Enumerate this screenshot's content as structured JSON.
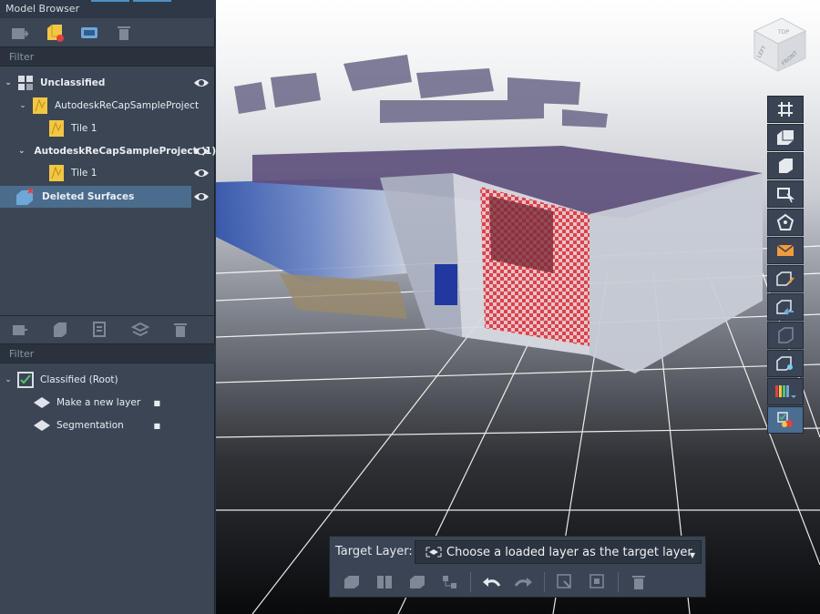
{
  "model_browser": {
    "title": "Model Browser",
    "filter_placeholder": "Filter",
    "toolbar_icons": [
      "import-icon",
      "add-layer-icon",
      "scan-icon",
      "trash-icon"
    ],
    "tree": {
      "unclassified": "Unclassified",
      "project_1": "AutodeskReCapSampleProject",
      "tile_1a": "Tile 1",
      "project_2": "AutodeskReCapSampleProject (1)",
      "tile_1b": "Tile 1",
      "deleted": "Deleted Surfaces"
    }
  },
  "classified_browser": {
    "filter_placeholder": "Filter",
    "toolbar_icons": [
      "import-icon",
      "layer-icon",
      "classify-icon",
      "layers-settings-icon",
      "trash-icon"
    ],
    "tree": {
      "root": "Classified (Root)",
      "make_layer": "Make a new layer",
      "segmentation": "Segmentation"
    }
  },
  "viewcube": {
    "top": "TOP",
    "left": "LEFT",
    "front": "FRONT"
  },
  "right_toolbar": [
    "grid-icon",
    "box-view-icon",
    "cube-icon",
    "crop-select-icon",
    "polygon-select-icon",
    "mail-icon",
    "edit-box-icon",
    "box-arrow-icon",
    "cube-outline-icon",
    "box-pin-icon",
    "color-bars-icon",
    "classify-tool-icon"
  ],
  "bottom_bar": {
    "label": "Target Layer:",
    "placeholder": "Choose a loaded layer as the target layer",
    "tools": [
      "move-icon",
      "split-icon",
      "cube-icon",
      "graph-icon",
      "undo-icon",
      "redo-icon",
      "select-points-icon",
      "select-region-icon",
      "trash-icon"
    ]
  },
  "colors": {
    "panel": "#3b4554",
    "selection": "#4c6c8d",
    "accent": "#4a90c8",
    "folder": "#f2c744",
    "bad": "#e34040"
  }
}
